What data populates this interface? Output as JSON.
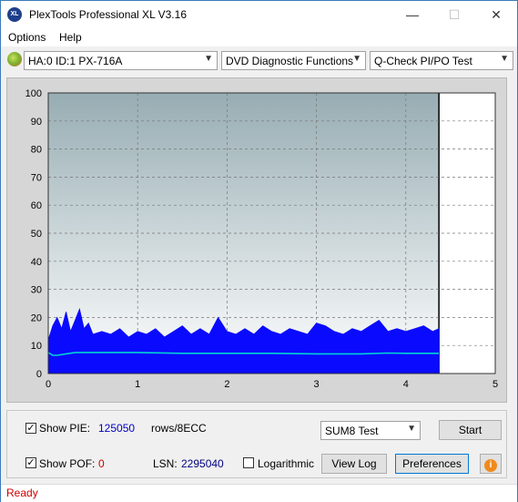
{
  "window": {
    "title": "PlexTools Professional XL V3.16",
    "icon_text": "XL"
  },
  "titlebar_buttons": {
    "minimize": "—",
    "maximize": "☐",
    "close": "✕"
  },
  "menu": {
    "options": "Options",
    "help": "Help"
  },
  "toolbar": {
    "drive": "HA:0 ID:1  PX-716A",
    "function": "DVD Diagnostic Functions",
    "test": "Q-Check PI/PO Test"
  },
  "colors": {
    "pi_fill": "#0a0aff",
    "pi_avg_line": "#00d2d2",
    "plot_top": "#97adb3",
    "plot_bottom": "#ffffff",
    "status_red": "#d00000"
  },
  "chart_data": {
    "type": "area",
    "xlabel": "",
    "ylabel": "",
    "xlim": [
      0,
      5
    ],
    "ylim": [
      0,
      100
    ],
    "x_ticks": [
      "0",
      "1",
      "2",
      "3",
      "4",
      "5"
    ],
    "y_ticks": [
      "0",
      "10",
      "20",
      "30",
      "40",
      "50",
      "60",
      "70",
      "80",
      "90",
      "100"
    ],
    "grid": true,
    "end_marker_x": 4.37,
    "series": [
      {
        "values": [
          [
            0.0,
            12
          ],
          [
            0.05,
            17
          ],
          [
            0.1,
            20
          ],
          [
            0.15,
            16
          ],
          [
            0.2,
            22
          ],
          [
            0.25,
            15
          ],
          [
            0.3,
            19
          ],
          [
            0.35,
            23
          ],
          [
            0.4,
            16
          ],
          [
            0.45,
            18
          ],
          [
            0.5,
            14
          ],
          [
            0.6,
            15
          ],
          [
            0.7,
            14
          ],
          [
            0.8,
            16
          ],
          [
            0.9,
            13
          ],
          [
            1.0,
            15
          ],
          [
            1.1,
            14
          ],
          [
            1.2,
            16
          ],
          [
            1.3,
            13
          ],
          [
            1.4,
            15
          ],
          [
            1.5,
            17
          ],
          [
            1.6,
            14
          ],
          [
            1.7,
            16
          ],
          [
            1.8,
            14
          ],
          [
            1.9,
            20
          ],
          [
            2.0,
            15
          ],
          [
            2.1,
            14
          ],
          [
            2.2,
            16
          ],
          [
            2.3,
            14
          ],
          [
            2.4,
            17
          ],
          [
            2.5,
            15
          ],
          [
            2.6,
            14
          ],
          [
            2.7,
            16
          ],
          [
            2.8,
            15
          ],
          [
            2.9,
            14
          ],
          [
            3.0,
            18
          ],
          [
            3.1,
            17
          ],
          [
            3.2,
            15
          ],
          [
            3.3,
            14
          ],
          [
            3.4,
            16
          ],
          [
            3.5,
            15
          ],
          [
            3.6,
            17
          ],
          [
            3.7,
            19
          ],
          [
            3.8,
            15
          ],
          [
            3.9,
            16
          ],
          [
            4.0,
            15
          ],
          [
            4.1,
            16
          ],
          [
            4.2,
            17
          ],
          [
            4.3,
            15
          ],
          [
            4.37,
            16
          ]
        ]
      },
      {
        "values": [
          [
            0.0,
            7.5
          ],
          [
            0.05,
            6.5
          ],
          [
            0.1,
            6.5
          ],
          [
            0.2,
            7
          ],
          [
            0.3,
            7.5
          ],
          [
            0.4,
            7.5
          ],
          [
            0.6,
            7.5
          ],
          [
            1.0,
            7.5
          ],
          [
            1.5,
            7.2
          ],
          [
            2.0,
            7.2
          ],
          [
            2.5,
            7.2
          ],
          [
            3.0,
            7
          ],
          [
            3.5,
            7
          ],
          [
            3.8,
            7.3
          ],
          [
            4.0,
            7.2
          ],
          [
            4.37,
            7.2
          ]
        ]
      }
    ]
  },
  "controls": {
    "show_pie_label": "Show PIE:",
    "pie_value": "125050",
    "pie_unit": "rows/8ECC",
    "show_pof_label": "Show POF:",
    "pof_value": "0",
    "lsn_label": "LSN:",
    "lsn_value": "2295040",
    "logarithmic_label": "Logarithmic",
    "sum_select": "SUM8 Test",
    "start_button": "Start",
    "view_log_button": "View Log",
    "preferences_button": "Preferences",
    "checkbox_mark": "✓",
    "info_mark": "i"
  },
  "status": {
    "text": "Ready"
  }
}
